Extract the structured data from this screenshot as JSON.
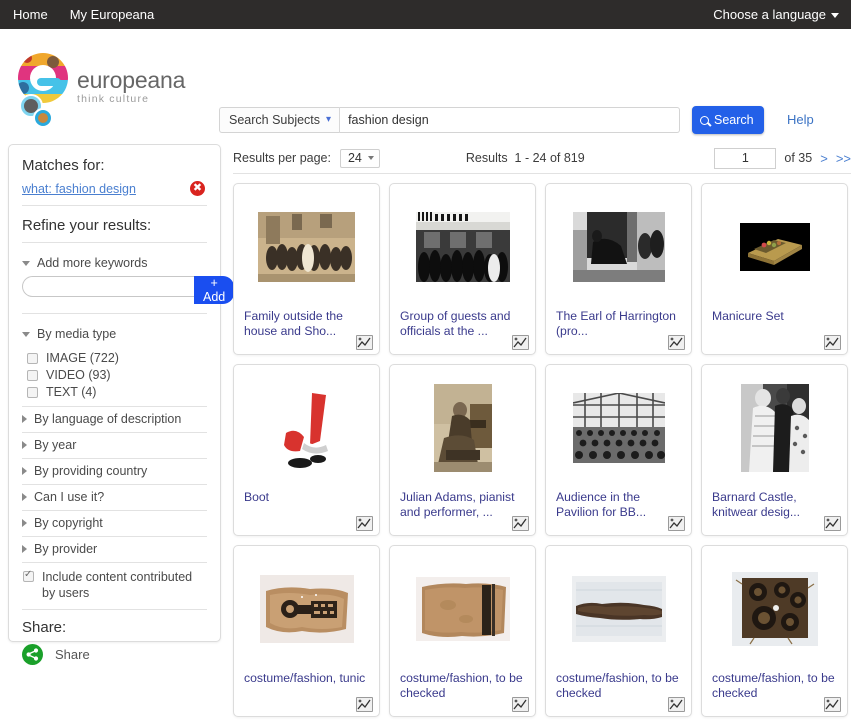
{
  "topnav": {
    "home": "Home",
    "my_europeana": "My Europeana",
    "language": "Choose a language"
  },
  "header": {
    "logo_title": "europeana",
    "logo_subtitle": "think culture",
    "search_scope": "Search Subjects",
    "search_value": "fashion design",
    "search_placeholder": "",
    "search_button": "Search",
    "help": "Help"
  },
  "sidebar": {
    "matches_heading": "Matches for:",
    "match_term": "what: fashion design",
    "refine_heading": "Refine your results:",
    "keywords_facet": "Add more keywords",
    "keywords_value": "",
    "keywords_placeholder": "",
    "add_button": "+ Add",
    "media_facet": "By media type",
    "media_types": [
      {
        "label": "IMAGE (722)",
        "checked": false
      },
      {
        "label": "VIDEO (93)",
        "checked": false
      },
      {
        "label": "TEXT (4)",
        "checked": false
      }
    ],
    "facets": [
      "By language of description",
      "By year",
      "By providing country",
      "Can I use it?",
      "By copyright",
      "By provider"
    ],
    "include_user_content": "Include content contributed by users",
    "include_user_content_checked": true,
    "share_heading": "Share:",
    "share_label": "Share"
  },
  "results": {
    "per_page_label": "Results per page:",
    "per_page_value": "24",
    "count_text": "Results  1 - 24 of 819",
    "page_value": "1",
    "of_pages": "of 35",
    "next": ">",
    "last": ">>",
    "items": [
      {
        "title": "Family outside the house and Sho...",
        "thumb": "sepia-group-building"
      },
      {
        "title": "Group of guests and officials at the ...",
        "thumb": "bw-crowd-shopfront"
      },
      {
        "title": "The Earl of Harrington (pro...",
        "thumb": "bw-horse-riders"
      },
      {
        "title": "Manicure Set",
        "thumb": "manicure-set-black"
      },
      {
        "title": "Boot",
        "thumb": "red-boot"
      },
      {
        "title": "Julian Adams, pianist and performer, ...",
        "thumb": "sepia-pianist"
      },
      {
        "title": "Audience in the Pavilion for BB...",
        "thumb": "bw-audience-hall"
      },
      {
        "title": "Barnard Castle, knitwear desig...",
        "thumb": "bw-knitwear-models"
      },
      {
        "title": "costume/fashion, tunic",
        "thumb": "textile-tunic"
      },
      {
        "title": "costume/fashion, to be checked",
        "thumb": "textile-panel"
      },
      {
        "title": "costume/fashion, to be checked",
        "thumb": "textile-strip"
      },
      {
        "title": "costume/fashion, to be checked",
        "thumb": "textile-pattern"
      }
    ]
  },
  "colors": {
    "topnav_bg": "#2e2c2b",
    "accent_blue": "#2360e8",
    "link_blue": "#4a7fd0",
    "title_blue": "#3a3a8c",
    "delete_red": "#d9241f",
    "share_green": "#1aa02a"
  }
}
